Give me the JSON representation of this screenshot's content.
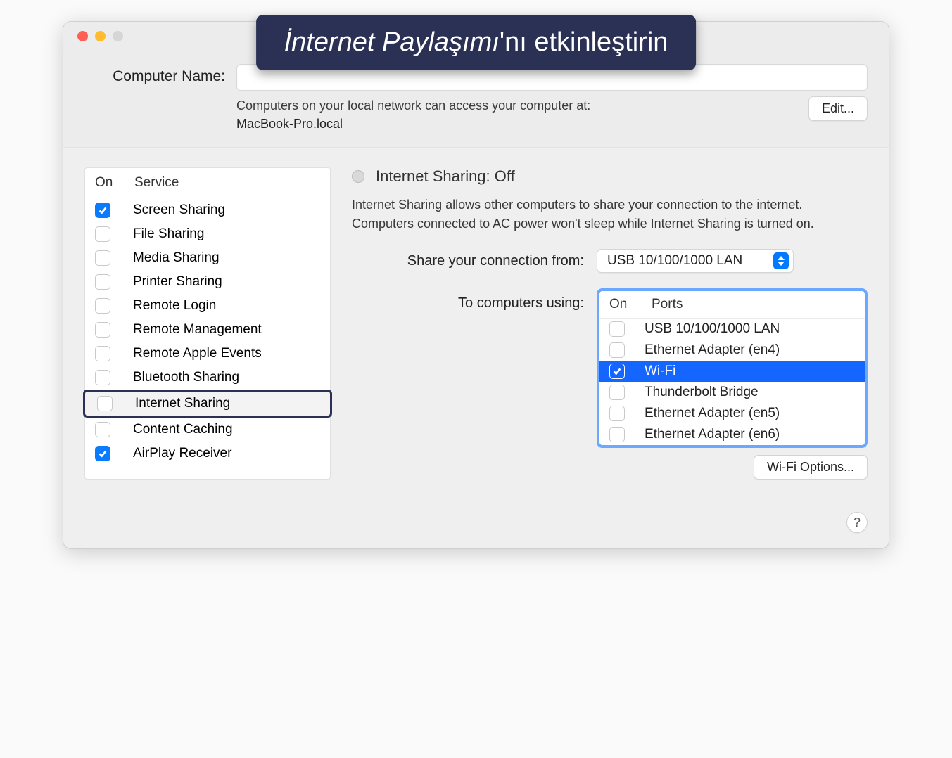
{
  "banner": {
    "italic": "İnternet Paylaşımı",
    "rest": "'nı etkinleştirin"
  },
  "computer_name": {
    "label": "Computer Name:",
    "value": "",
    "subtext_line1": "Computers on your local network can access your computer at:",
    "hostname": "MacBook-Pro.local",
    "edit_button": "Edit..."
  },
  "services": {
    "header_on": "On",
    "header_service": "Service",
    "items": [
      {
        "label": "Screen Sharing",
        "checked": true,
        "selected": false
      },
      {
        "label": "File Sharing",
        "checked": false,
        "selected": false
      },
      {
        "label": "Media Sharing",
        "checked": false,
        "selected": false
      },
      {
        "label": "Printer Sharing",
        "checked": false,
        "selected": false
      },
      {
        "label": "Remote Login",
        "checked": false,
        "selected": false
      },
      {
        "label": "Remote Management",
        "checked": false,
        "selected": false
      },
      {
        "label": "Remote Apple Events",
        "checked": false,
        "selected": false
      },
      {
        "label": "Bluetooth Sharing",
        "checked": false,
        "selected": false
      },
      {
        "label": "Internet Sharing",
        "checked": false,
        "selected": true
      },
      {
        "label": "Content Caching",
        "checked": false,
        "selected": false
      },
      {
        "label": "AirPlay Receiver",
        "checked": true,
        "selected": false
      }
    ]
  },
  "detail": {
    "status_title": "Internet Sharing: Off",
    "description": "Internet Sharing allows other computers to share your connection to the internet. Computers connected to AC power won't sleep while Internet Sharing is turned on.",
    "share_from_label": "Share your connection from:",
    "share_from_value": "USB 10/100/1000 LAN",
    "to_label": "To computers using:",
    "ports_header_on": "On",
    "ports_header_ports": "Ports",
    "ports": [
      {
        "label": "USB 10/100/1000 LAN",
        "checked": false,
        "selected": false
      },
      {
        "label": "Ethernet Adapter (en4)",
        "checked": false,
        "selected": false
      },
      {
        "label": "Wi-Fi",
        "checked": true,
        "selected": true
      },
      {
        "label": "Thunderbolt Bridge",
        "checked": false,
        "selected": false
      },
      {
        "label": "Ethernet Adapter (en5)",
        "checked": false,
        "selected": false
      },
      {
        "label": "Ethernet Adapter (en6)",
        "checked": false,
        "selected": false
      }
    ],
    "wifi_options_button": "Wi-Fi Options..."
  },
  "help_glyph": "?"
}
